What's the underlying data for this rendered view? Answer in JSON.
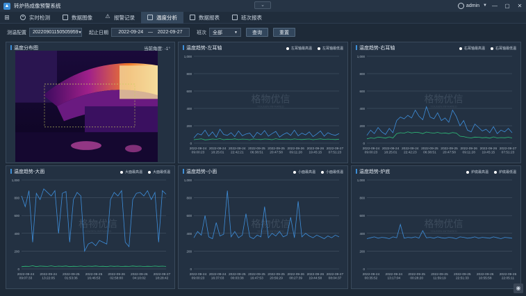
{
  "app": {
    "title": "转炉热成像预警系统",
    "center_control": "⌄",
    "user": "admin"
  },
  "window_controls": [
    "—",
    "▢",
    "✕"
  ],
  "nav": {
    "tabs": [
      {
        "label": "实时检测",
        "icon": "camera-icon"
      },
      {
        "label": "数据图像",
        "icon": "document-icon"
      },
      {
        "label": "报警记录",
        "icon": "warning-icon"
      },
      {
        "label": "温度分析",
        "icon": "document-icon",
        "active": true
      },
      {
        "label": "数据报表",
        "icon": "document-icon"
      },
      {
        "label": "班次报表",
        "icon": "document-icon"
      }
    ]
  },
  "toolbar": {
    "config_label": "测温配置",
    "config_value": "20220901150505959",
    "date_label": "起止日期",
    "date_start": "2022-09-24",
    "date_sep": "—",
    "date_end": "2022-09-27",
    "shift_label": "班次",
    "shift_value": "全部",
    "query_label": "查询",
    "reset_label": "重置"
  },
  "panels": {
    "distribution": {
      "title": "温度分布图",
      "angle_label": "当前角度: -1°"
    },
    "watermark": {
      "cn": "格物优信",
      "en": "YOUSEN INFRARED"
    }
  },
  "colors": {
    "series_primary": "#3e8fdc",
    "series_secondary": "#2fbf7a",
    "grid": "#4d5d6f",
    "panel": "#233142"
  },
  "chart_data": [
    {
      "type": "line",
      "title": "温度趋势-左耳轴",
      "legend": [
        "左耳轴最高温",
        "左耳轴最低温"
      ],
      "ylim": [
        0,
        1000
      ],
      "yticks": [
        "1,000",
        "800",
        "600",
        "400",
        "200",
        "0"
      ],
      "x": [
        "2022-09-24 09:00:23",
        "2022-09-24 18:25:01",
        "2022-09-24 22:42:21",
        "2022-09-25 06:38:51",
        "2022-09-25 20:47:58",
        "2022-09-26 09:11:28",
        "2022-09-26 19:45:15",
        "2022-09-27 07:51:23"
      ],
      "series": [
        {
          "name": "左耳轴最高温",
          "values": [
            60,
            110,
            95,
            150,
            80,
            130,
            70,
            160,
            100,
            90,
            120,
            75,
            140,
            85,
            105,
            115,
            65,
            125,
            95,
            145,
            80,
            110,
            135,
            70,
            100,
            120,
            90,
            150,
            85,
            115,
            95,
            130,
            75,
            105,
            140,
            80,
            120,
            100,
            90,
            110
          ],
          "color": "#3e8fdc"
        },
        {
          "name": "左耳轴最低温",
          "values": [
            40,
            45,
            50,
            38,
            42,
            48,
            44,
            52,
            40,
            46,
            43,
            50,
            41,
            47,
            45,
            39,
            49,
            44,
            42,
            48,
            46,
            40,
            51,
            43,
            45,
            47,
            41,
            49,
            44,
            42,
            46,
            48,
            40,
            45,
            50,
            43,
            47,
            44,
            42,
            46
          ],
          "color": "#2fbf7a"
        }
      ]
    },
    {
      "type": "line",
      "title": "温度趋势-右耳轴",
      "legend": [
        "右耳轴最高温",
        "右耳轴最低温"
      ],
      "ylim": [
        0,
        1000
      ],
      "yticks": [
        "1,000",
        "800",
        "600",
        "400",
        "200",
        "0"
      ],
      "x": [
        "2022-09-24 09:00:23",
        "2022-09-24 18:25:01",
        "2022-09-24 22:42:23",
        "2022-09-25 06:38:51",
        "2022-09-25 20:47:58",
        "2022-09-26 09:11:28",
        "2022-09-26 19:45:15",
        "2022-09-27 07:51:23"
      ],
      "series": [
        {
          "name": "右耳轴最高温",
          "values": [
            90,
            150,
            110,
            180,
            130,
            100,
            170,
            120,
            260,
            300,
            280,
            320,
            290,
            380,
            310,
            270,
            420,
            300,
            280,
            350,
            260,
            290,
            240,
            380,
            310,
            200,
            260,
            150,
            130,
            220,
            180,
            140,
            160,
            120,
            190,
            110,
            150,
            130,
            170,
            120
          ],
          "color": "#3e8fdc"
        },
        {
          "name": "右耳轴最低温",
          "values": [
            50,
            60,
            55,
            70,
            65,
            58,
            72,
            60,
            110,
            120,
            115,
            130,
            118,
            125,
            122,
            110,
            128,
            120,
            115,
            124,
            112,
            118,
            110,
            122,
            116,
            80,
            75,
            65,
            60,
            70,
            68,
            62,
            66,
            58,
            72,
            60,
            64,
            62,
            68,
            60
          ],
          "color": "#2fbf7a"
        }
      ]
    },
    {
      "type": "line",
      "title": "温度趋势-大面",
      "legend": [
        "大面最高温",
        "大面最低温"
      ],
      "ylim": [
        0,
        1000
      ],
      "yticks": [
        "1,000",
        "800",
        "600",
        "400",
        "200",
        "0"
      ],
      "x": [
        "2022-09-24 09:07:33",
        "2022-09-24 13:22:05",
        "2022-09-25 01:53:36",
        "2022-09-25 16:46:53",
        "2022-09-26 02:58:00",
        "2022-09-26 04:10:02",
        "2022-09-27 18:28:42"
      ],
      "series": [
        {
          "name": "大面最高温",
          "values": [
            820,
            700,
            880,
            300,
            850,
            780,
            900,
            860,
            820,
            880,
            400,
            850,
            870,
            300,
            780,
            860,
            820,
            200,
            280,
            300,
            260,
            320,
            300,
            280,
            780,
            860,
            820,
            880,
            300,
            250,
            780,
            850,
            860,
            820,
            880,
            780,
            860,
            300,
            880,
            840
          ],
          "color": "#3e8fdc"
        },
        {
          "name": "大面最低温",
          "values": [
            25,
            30,
            28,
            35,
            26,
            32,
            30,
            28,
            34,
            27,
            31,
            29,
            33,
            26,
            30,
            28,
            32,
            27,
            31,
            29,
            33,
            28,
            30,
            26,
            32,
            29,
            31,
            27,
            30,
            28,
            33,
            29,
            31,
            27,
            30,
            28,
            32,
            29,
            31,
            28
          ],
          "color": "#2fbf7a"
        }
      ]
    },
    {
      "type": "line",
      "title": "温度趋势-小面",
      "legend": [
        "小面最高温",
        "小面最低温"
      ],
      "ylim": [
        0,
        1000
      ],
      "yticks": [
        "1,000",
        "800",
        "600",
        "400",
        "200",
        "0"
      ],
      "x": [
        "2022-09-24 09:00:23",
        "2022-09-24 16:37:03",
        "2022-09-25 00:03:38",
        "2022-09-25 16:47:53",
        "2022-09-25 20:56:29",
        "2022-09-26 08:27:39",
        "2022-09-26 19:44:58",
        "2022-09-27 08:04:37"
      ],
      "series": [
        {
          "name": "小面最高温",
          "values": [
            350,
            420,
            380,
            600,
            360,
            340,
            520,
            370,
            390,
            880,
            360,
            420,
            350,
            380,
            620,
            360,
            340,
            380,
            360,
            700,
            350,
            400,
            370,
            420,
            360,
            380,
            580,
            350,
            760,
            360,
            400,
            370,
            350,
            380,
            360,
            340,
            370,
            350,
            380,
            360
          ],
          "color": "#3e8fdc"
        },
        {
          "name": "小面最低温",
          "values": [],
          "color": "#2fbf7a"
        }
      ]
    },
    {
      "type": "line",
      "title": "温度趋势-炉底",
      "legend": [
        "炉底最高温",
        "炉底最低温"
      ],
      "ylim": [
        0,
        1000
      ],
      "yticks": [
        "1,000",
        "800",
        "600",
        "400",
        "200",
        "0"
      ],
      "x": [
        "2022-09-24 00:35:52",
        "2022-09-24 13:17:04",
        "2022-09-25 00:28:20",
        "2022-09-25 11:59:19",
        "2022-09-25 22:51:33",
        "2022-09-26 10:55:58",
        "2022-09-26 22:05:11"
      ],
      "series": [
        {
          "name": "炉底最高温",
          "values": [
            340,
            350,
            360,
            345,
            355,
            350,
            340,
            360,
            350,
            500,
            345,
            355,
            350,
            360,
            345,
            430,
            350,
            355,
            345,
            360,
            350,
            345,
            355,
            350,
            340,
            360,
            355,
            345,
            350,
            360,
            345,
            355,
            350,
            345,
            360,
            350,
            340,
            355,
            350,
            345
          ],
          "color": "#3e8fdc"
        },
        {
          "name": "炉底最低温",
          "values": [],
          "color": "#2fbf7a"
        }
      ]
    }
  ]
}
